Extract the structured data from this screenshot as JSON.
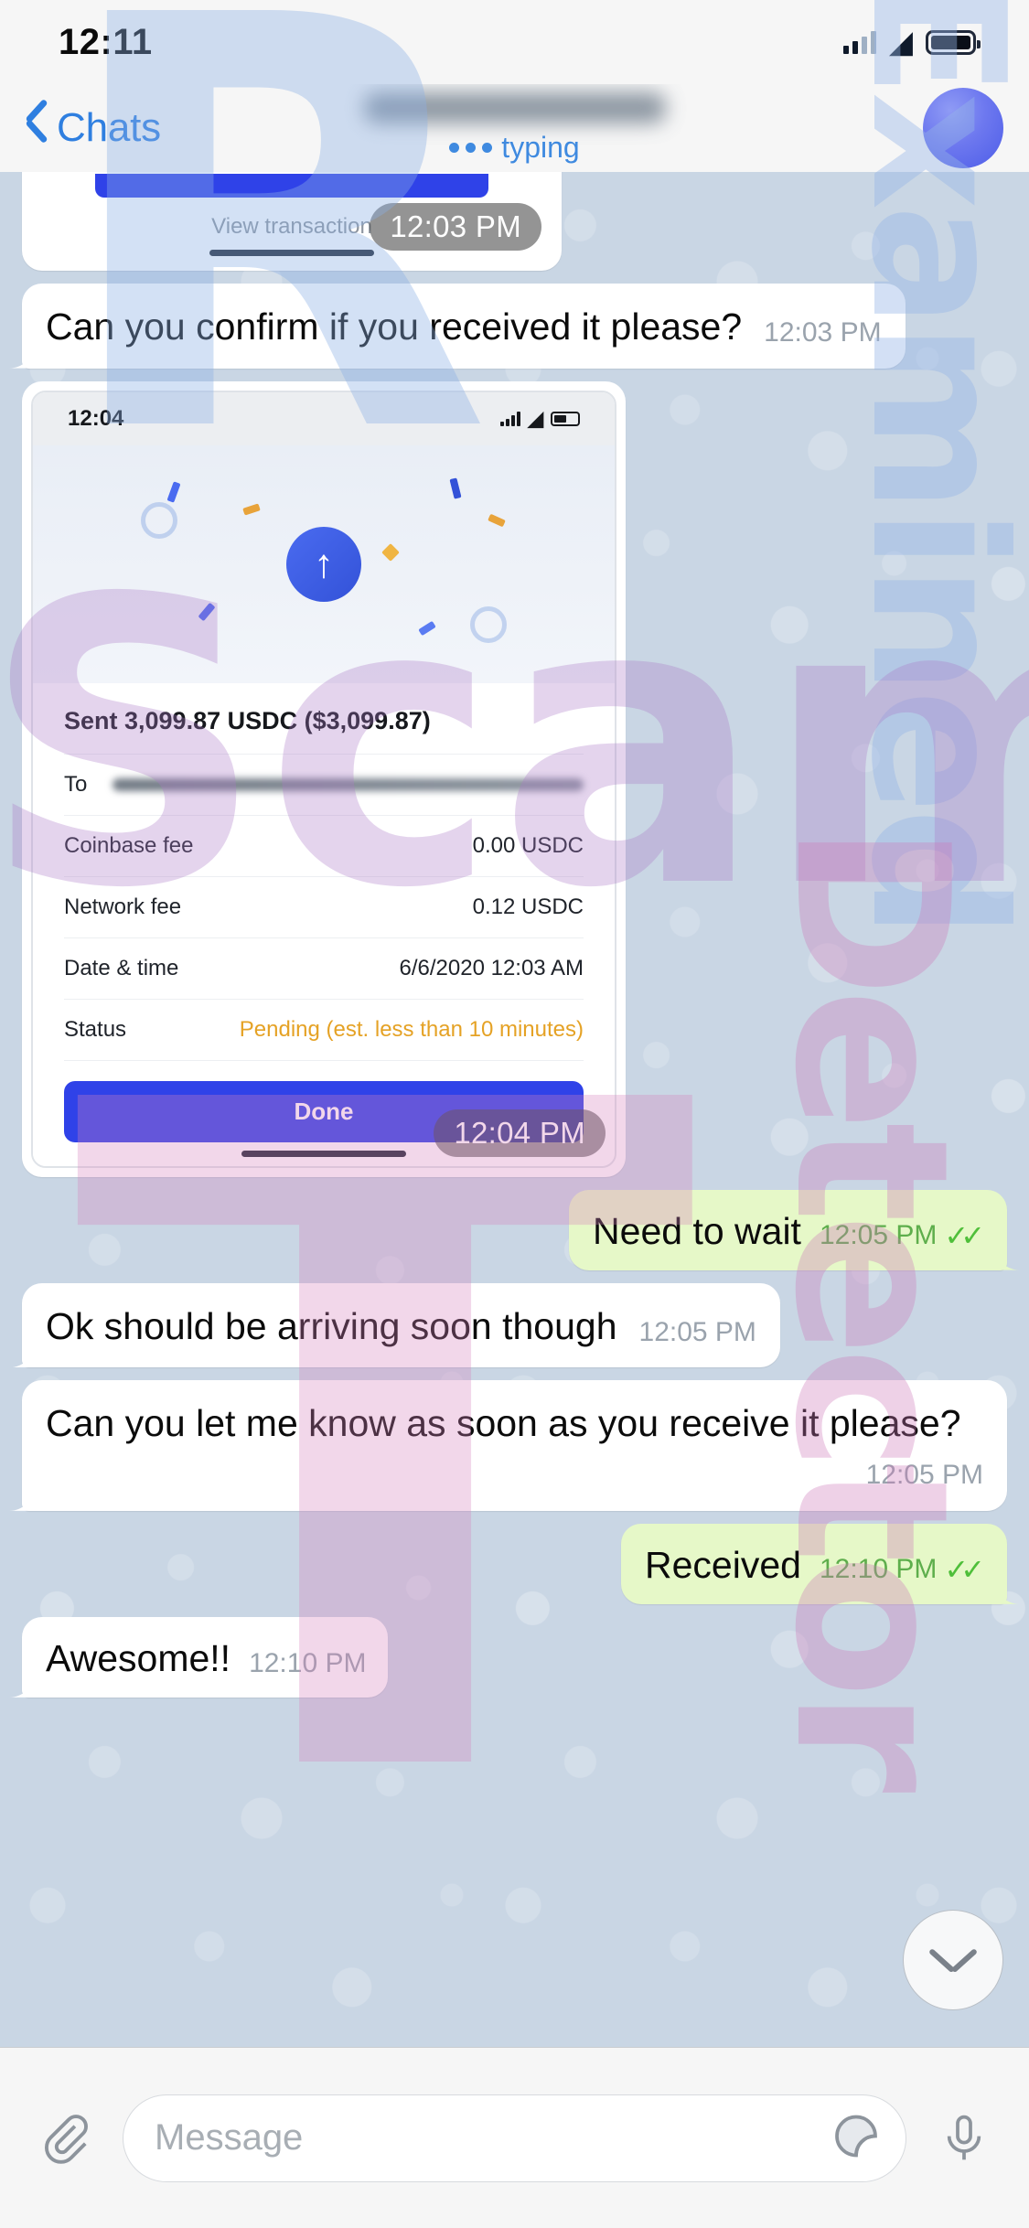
{
  "status_bar": {
    "time": "12:11",
    "signal_icon": "signal-bars-icon",
    "wifi_icon": "wifi-icon",
    "battery_icon": "battery-icon"
  },
  "nav": {
    "back_label": "Chats",
    "back_icon": "chevron-left-icon",
    "title": "",
    "typing_label": "typing",
    "typing_dots_icon": "typing-dots-icon",
    "avatar_icon": "contact-avatar"
  },
  "messages": [
    {
      "id": "msg-photo-1",
      "type": "photo-partial",
      "direction": "in",
      "link_label": "View transaction",
      "time": "12:03 PM"
    },
    {
      "id": "msg-text-1",
      "type": "text",
      "direction": "in",
      "text": "Can you confirm if you received it please?",
      "time": "12:03 PM"
    },
    {
      "id": "msg-photo-2",
      "type": "photo-receipt",
      "direction": "in",
      "time": "12:04 PM",
      "screenshot": {
        "status_time": "12:04",
        "title": "Sent 3,099.87 USDC ($3,099.87)",
        "rows": [
          {
            "key": "To",
            "value": "",
            "redacted": true
          },
          {
            "key": "Coinbase fee",
            "value": "0.00 USDC",
            "redacted": false
          },
          {
            "key": "Network fee",
            "value": "0.12 USDC",
            "redacted": false
          },
          {
            "key": "Date & time",
            "value": "6/6/2020 12:03 AM",
            "redacted": false
          },
          {
            "key": "Status",
            "value": "Pending (est. less than 10 minutes)",
            "redacted": false,
            "pending": true
          }
        ],
        "button_label": "Done",
        "upload_icon": "upload-arrow-icon"
      }
    },
    {
      "id": "msg-text-2",
      "type": "text",
      "direction": "out",
      "text": "Need to wait",
      "time": "12:05 PM",
      "ticks": "✓✓",
      "compact": true
    },
    {
      "id": "msg-text-3",
      "type": "text",
      "direction": "in",
      "text": "Ok should be arriving soon though",
      "time": "12:05 PM"
    },
    {
      "id": "msg-text-4",
      "type": "text",
      "direction": "in",
      "text": "Can you let me know as soon as you receive it please?",
      "time": "12:05 PM"
    },
    {
      "id": "msg-text-5",
      "type": "text",
      "direction": "out",
      "text": "Received",
      "time": "12:10 PM",
      "ticks": "✓✓",
      "compact": true
    },
    {
      "id": "msg-text-6",
      "type": "text",
      "direction": "in",
      "text": "Awesome!!",
      "time": "12:10 PM",
      "compact": true
    }
  ],
  "scroll_button": {
    "icon": "chevron-down-icon"
  },
  "input_bar": {
    "attach_icon": "paperclip-icon",
    "placeholder": "Message",
    "sticker_icon": "sticker-icon",
    "mic_icon": "microphone-icon"
  },
  "watermark": {
    "blue_letter": "R",
    "blue_vertical": "Examined",
    "pink_word": "Scam",
    "pink_vertical": "Detector",
    "pink_letter": "T"
  },
  "colors": {
    "accent_blue": "#2f7fe0",
    "bubble_out": "#e6f8c8",
    "bubble_in": "#ffffff",
    "wallpaper": "#c9d6e4",
    "tick_green": "#4fbf3a",
    "pending_orange": "#e5a225",
    "button_blue": "#2f42e8"
  }
}
